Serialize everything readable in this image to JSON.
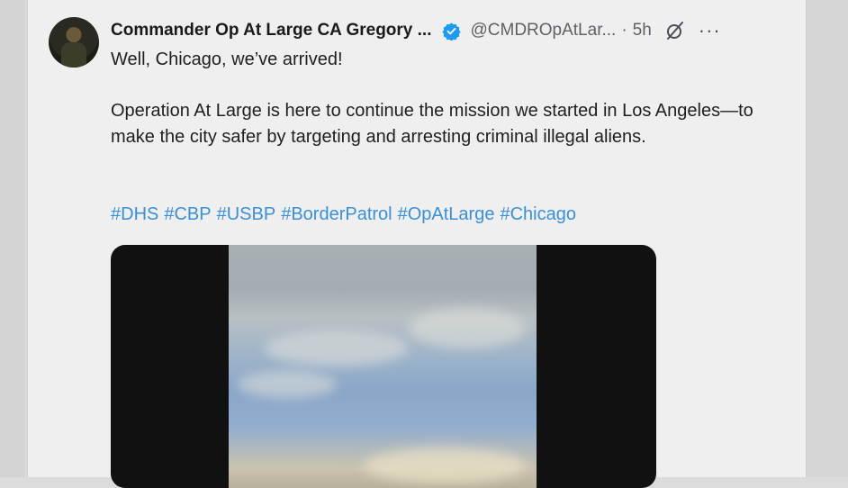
{
  "post": {
    "author_name": "Commander Op At Large CA Gregory ...",
    "handle": "@CMDROpAtLar...",
    "separator": "·",
    "time": "5h",
    "more": "···",
    "line1": "Well, Chicago, we’ve arrived!",
    "paragraph": "Operation At Large is here to continue the mission we started in Los Angeles—to make the city safer by targeting and arresting criminal illegal aliens.",
    "hashtags": [
      "#DHS",
      "#CBP",
      "#USBP",
      "#BorderPatrol",
      "#OpAtLarge",
      "#Chicago"
    ]
  },
  "icons": {
    "verified": "verified-badge-icon",
    "grok": "grok-icon",
    "more": "more-icon"
  },
  "colors": {
    "link": "#3a8fd6",
    "verified": "#1d9bf0",
    "muted": "#5b6168"
  }
}
